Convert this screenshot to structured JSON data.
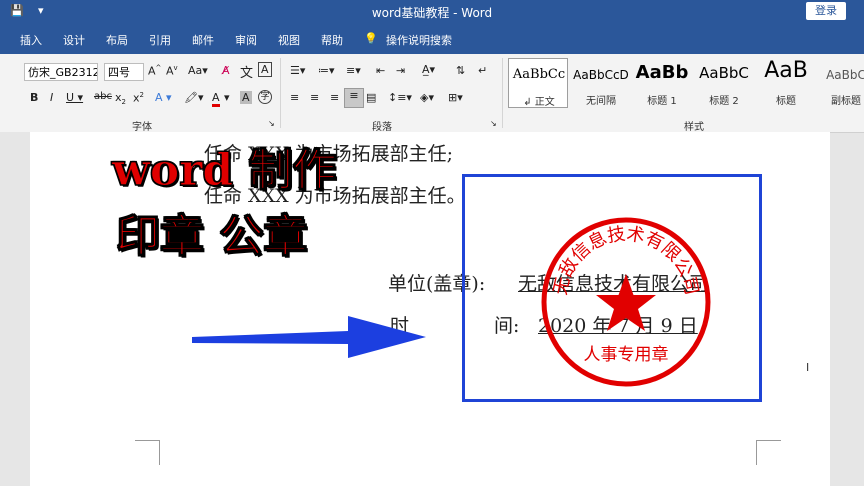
{
  "window": {
    "title": "word基础教程  -  Word",
    "login_label": "登录"
  },
  "tabs": [
    "插入",
    "设计",
    "布局",
    "引用",
    "邮件",
    "审阅",
    "视图",
    "帮助"
  ],
  "tell_me": "操作说明搜索",
  "ribbon": {
    "font_name": "仿宋_GB2312",
    "font_size": "四号",
    "font_group_label": "字体",
    "paragraph_group_label": "段落",
    "styles_group_label": "样式",
    "styles": [
      {
        "sample": "AaBbCc",
        "name": "↲ 正文"
      },
      {
        "sample": "AaBbCcD",
        "name": "无间隔"
      },
      {
        "sample": "AaBb",
        "name": "标题 1"
      },
      {
        "sample": "AaBbC",
        "name": "标题 2"
      },
      {
        "sample": "AaB",
        "name": "标题"
      },
      {
        "sample": "AaBbC",
        "name": "副标题"
      }
    ]
  },
  "document": {
    "line1": "任命 XXX 为市场拓展部主任;",
    "line2": "任命 XXX 为市场拓展部主任。",
    "unit_label": "单位(盖章):",
    "unit_value": "无敌信息技术有限公司",
    "time_label": "时",
    "time_label2": "间:",
    "time_value": "2020 年 7 月 9 日"
  },
  "overlay": {
    "line1": "word 制作",
    "line2": "印章  公章"
  },
  "seal": {
    "arc_text": "无敌信息技术有限公司",
    "bottom_text": "人事专用章",
    "color": "#e10000"
  },
  "colors": {
    "ribbon_blue": "#2b579a",
    "frame_blue": "#1f44d6",
    "arrow_blue": "#1c3fe0",
    "seal_red": "#e10000"
  }
}
